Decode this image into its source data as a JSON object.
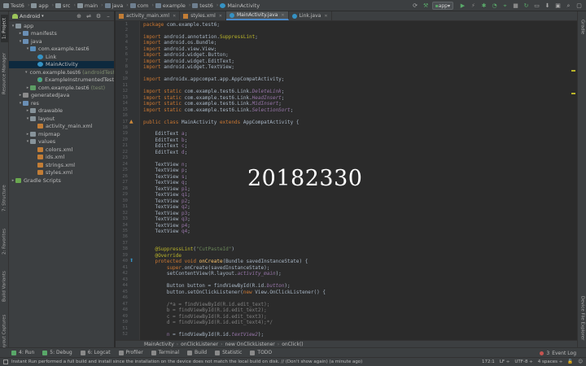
{
  "breadcrumb": [
    "Test6",
    "app",
    "src",
    "main",
    "java",
    "com",
    "example",
    "test6",
    "MainActivity"
  ],
  "run_config": "app",
  "left_tabs": [
    "1: Project",
    "Resource Manager",
    "7: Structure",
    "2: Favorites",
    "Build Variants",
    "Layout Captures"
  ],
  "right_tabs": [
    "Gradle",
    "Device File Explorer"
  ],
  "project": {
    "view_selector": "Android",
    "tree": [
      {
        "label": "app",
        "depth": 0,
        "arrow": "▾",
        "icon": "fold",
        "selected": false,
        "suffix": ""
      },
      {
        "label": "manifests",
        "depth": 1,
        "arrow": "▸",
        "icon": "fold-blue",
        "selected": false,
        "suffix": ""
      },
      {
        "label": "java",
        "depth": 1,
        "arrow": "▾",
        "icon": "fold-blue",
        "selected": false,
        "suffix": ""
      },
      {
        "label": "com.example.test6",
        "depth": 2,
        "arrow": "▾",
        "icon": "fold-src",
        "selected": false,
        "suffix": ""
      },
      {
        "label": "Link",
        "depth": 3,
        "arrow": "",
        "icon": "java",
        "selected": false,
        "suffix": ""
      },
      {
        "label": "MainActivity",
        "depth": 3,
        "arrow": "",
        "icon": "java",
        "selected": true,
        "suffix": ""
      },
      {
        "label": "com.example.test6",
        "depth": 2,
        "arrow": "▾",
        "icon": "fold-test",
        "selected": false,
        "suffix": "(androidTest)"
      },
      {
        "label": "ExampleInstrumentedTest",
        "depth": 3,
        "arrow": "",
        "icon": "jtest",
        "selected": false,
        "suffix": ""
      },
      {
        "label": "com.example.test6",
        "depth": 2,
        "arrow": "▸",
        "icon": "fold-test",
        "selected": false,
        "suffix": "(test)"
      },
      {
        "label": "generatedJava",
        "depth": 1,
        "arrow": "▸",
        "icon": "fold-gen",
        "selected": false,
        "suffix": ""
      },
      {
        "label": "res",
        "depth": 1,
        "arrow": "▾",
        "icon": "fold-blue",
        "selected": false,
        "suffix": ""
      },
      {
        "label": "drawable",
        "depth": 2,
        "arrow": "▸",
        "icon": "fold",
        "selected": false,
        "suffix": ""
      },
      {
        "label": "layout",
        "depth": 2,
        "arrow": "▾",
        "icon": "fold",
        "selected": false,
        "suffix": ""
      },
      {
        "label": "activity_main.xml",
        "depth": 3,
        "arrow": "",
        "icon": "xml",
        "selected": false,
        "suffix": ""
      },
      {
        "label": "mipmap",
        "depth": 2,
        "arrow": "▸",
        "icon": "fold",
        "selected": false,
        "suffix": ""
      },
      {
        "label": "values",
        "depth": 2,
        "arrow": "▾",
        "icon": "fold",
        "selected": false,
        "suffix": ""
      },
      {
        "label": "colors.xml",
        "depth": 3,
        "arrow": "",
        "icon": "xml",
        "selected": false,
        "suffix": ""
      },
      {
        "label": "ids.xml",
        "depth": 3,
        "arrow": "",
        "icon": "xml",
        "selected": false,
        "suffix": ""
      },
      {
        "label": "strings.xml",
        "depth": 3,
        "arrow": "",
        "icon": "xml",
        "selected": false,
        "suffix": ""
      },
      {
        "label": "styles.xml",
        "depth": 3,
        "arrow": "",
        "icon": "xml",
        "selected": false,
        "suffix": ""
      },
      {
        "label": "Gradle Scripts",
        "depth": 0,
        "arrow": "▸",
        "icon": "gradle",
        "selected": false,
        "suffix": ""
      }
    ]
  },
  "editor_tabs": [
    {
      "label": "activity_main.xml",
      "icon": "xml",
      "active": false
    },
    {
      "label": "styles.xml",
      "icon": "xml",
      "active": false
    },
    {
      "label": "MainActivity.java",
      "icon": "java",
      "active": true
    },
    {
      "label": "Link.java",
      "icon": "java",
      "active": false
    }
  ],
  "code_lines": [
    {
      "n": 1,
      "h": "<span class=\"kw\">package</span> com.example.test6;"
    },
    {
      "n": 2,
      "h": ""
    },
    {
      "n": 3,
      "h": "<span class=\"kw\">import</span> android.annotation.<span class=\"an\">SuppressLint</span>;"
    },
    {
      "n": 4,
      "h": "<span class=\"kw\">import</span> android.os.Bundle;"
    },
    {
      "n": 5,
      "h": "<span class=\"kw\">import</span> android.view.View;"
    },
    {
      "n": 6,
      "h": "<span class=\"kw\">import</span> android.widget.Button;"
    },
    {
      "n": 7,
      "h": "<span class=\"kw\">import</span> android.widget.EditText;"
    },
    {
      "n": 8,
      "h": "<span class=\"kw\">import</span> android.widget.TextView;"
    },
    {
      "n": 9,
      "h": ""
    },
    {
      "n": 10,
      "h": "<span class=\"kw\">import</span> androidx.appcompat.app.AppCompatActivity;"
    },
    {
      "n": 11,
      "h": ""
    },
    {
      "n": 12,
      "h": "<span class=\"kw\">import static</span> com.example.test6.Link.<span class=\"it\">DeleteLink</span>;"
    },
    {
      "n": 13,
      "h": "<span class=\"kw\">import static</span> com.example.test6.Link.<span class=\"it\">HeadInsert</span>;"
    },
    {
      "n": 14,
      "h": "<span class=\"kw\">import static</span> com.example.test6.Link.<span class=\"it\">MidInsert</span>;"
    },
    {
      "n": 15,
      "h": "<span class=\"kw\">import static</span> com.example.test6.Link.<span class=\"it\">SelectionSort</span>;"
    },
    {
      "n": 16,
      "h": ""
    },
    {
      "n": 17,
      "h": "<span class=\"kw\">public class</span> MainActivity <span class=\"kw\">extends</span> AppCompatActivity {"
    },
    {
      "n": 18,
      "h": ""
    },
    {
      "n": 19,
      "h": "    EditText <span class=\"fld\">a</span>;"
    },
    {
      "n": 20,
      "h": "    EditText <span class=\"fld\">b</span>;"
    },
    {
      "n": 21,
      "h": "    EditText <span class=\"fld\">c</span>;"
    },
    {
      "n": 22,
      "h": "    EditText <span class=\"fld\">d</span>;"
    },
    {
      "n": 23,
      "h": ""
    },
    {
      "n": 24,
      "h": "    TextView <span class=\"fld\">n</span>;"
    },
    {
      "n": 25,
      "h": "    TextView <span class=\"fld\">p</span>;"
    },
    {
      "n": 26,
      "h": "    TextView <span class=\"fld\">s</span>;"
    },
    {
      "n": 27,
      "h": "    TextView <span class=\"fld\">q</span>;"
    },
    {
      "n": 28,
      "h": "    TextView <span class=\"fld\">p1</span>;"
    },
    {
      "n": 29,
      "h": "    TextView <span class=\"fld\">q1</span>;"
    },
    {
      "n": 30,
      "h": "    TextView <span class=\"fld\">p2</span>;"
    },
    {
      "n": 31,
      "h": "    TextView <span class=\"fld\">q2</span>;"
    },
    {
      "n": 32,
      "h": "    TextView <span class=\"fld\">p3</span>;"
    },
    {
      "n": 33,
      "h": "    TextView <span class=\"fld\">q3</span>;"
    },
    {
      "n": 34,
      "h": "    TextView <span class=\"fld\">p4</span>;"
    },
    {
      "n": 35,
      "h": "    TextView <span class=\"fld\">q4</span>;"
    },
    {
      "n": 36,
      "h": ""
    },
    {
      "n": 37,
      "h": ""
    },
    {
      "n": 38,
      "h": "    <span class=\"an\">@SuppressLint</span>(<span class=\"st\">\"CutPasteId\"</span>)"
    },
    {
      "n": 39,
      "h": "    <span class=\"an\">@Override</span>"
    },
    {
      "n": 40,
      "h": "    <span class=\"kw\">protected void</span> <span class=\"fn\">onCreate</span>(Bundle savedInstanceState) {"
    },
    {
      "n": 41,
      "h": "        <span class=\"kw\">super</span>.onCreate(savedInstanceState);"
    },
    {
      "n": 42,
      "h": "        setContentView(R.layout.<span class=\"it\">activity_main</span>);"
    },
    {
      "n": 43,
      "h": ""
    },
    {
      "n": 44,
      "h": "        Button button = findViewById(R.id.<span class=\"it\">button</span>);"
    },
    {
      "n": 45,
      "h": "        button.setOnClickListener(<span class=\"kw\">new</span> View.OnClickListener() {"
    },
    {
      "n": 46,
      "h": ""
    },
    {
      "n": 47,
      "h": "        <span class=\"cm\">/*a = findViewById(R.id.edit_text);</span>"
    },
    {
      "n": 48,
      "h": "        <span class=\"cm\">b = findViewById(R.id.edit_text2);</span>"
    },
    {
      "n": 49,
      "h": "        <span class=\"cm\">c = findViewById(R.id.edit_text3);</span>"
    },
    {
      "n": 50,
      "h": "        <span class=\"cm\">d = findViewById(R.id.edit_text4);*/</span>"
    },
    {
      "n": 51,
      "h": ""
    },
    {
      "n": 52,
      "h": "        <span class=\"fld\">n</span> = findViewById(R.id.<span class=\"it\">textView2</span>);"
    }
  ],
  "overlay_text": "20182330",
  "editor_breadcrumb": [
    "MainActivity",
    "onClickListener",
    "new OnClickListener",
    "onClick()"
  ],
  "tool_windows": [
    "6: Logcat",
    "Profiler",
    "Terminal",
    "Build",
    "Statistic",
    "TODO"
  ],
  "tool_windows_first": [
    "4: Run",
    "5: Debug"
  ],
  "event_log": "Event Log",
  "event_log_count": "3",
  "status_message": "Instant Run performed a full build and install since the installation on the device does not match the local build on disk. // (Don't show again) (a minute ago)",
  "status_right": [
    "172:1",
    "LF ÷",
    "UTF-8 ÷",
    "4 spaces ÷"
  ],
  "colors": {
    "accent": "#4a88c7",
    "selection": "#0d293e",
    "bg": "#2b2b2b"
  }
}
